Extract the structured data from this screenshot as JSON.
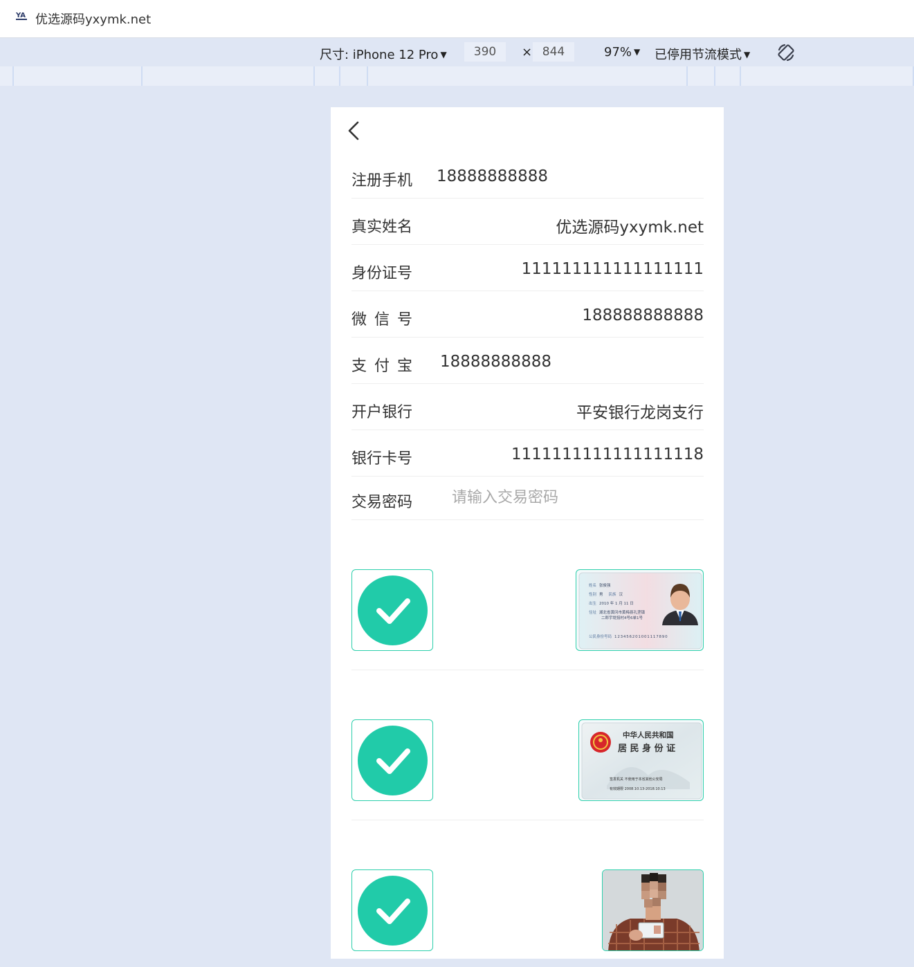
{
  "browser": {
    "tab_title": "优选源码yxymk.net",
    "favicon": "site-logo-icon"
  },
  "devtools": {
    "size_label": "尺寸: iPhone 12 Pro",
    "width": "390",
    "times": "×",
    "height": "844",
    "zoom": "97%",
    "throttle": "已停用节流模式",
    "rotate_icon": "rotate-icon"
  },
  "form": {
    "rows": [
      {
        "label": "注册手机",
        "value": "18888888888",
        "align": "left"
      },
      {
        "label": "真实姓名",
        "value": "优选源码yxymk.net",
        "align": "right"
      },
      {
        "label": "身份证号",
        "value": "111111111111111111",
        "align": "right"
      },
      {
        "label": "微 信 号",
        "value": "188888888888",
        "align": "right"
      },
      {
        "label": "支 付 宝",
        "value": "18888888888",
        "align": "left"
      },
      {
        "label": "开户银行",
        "value": "平安银行龙岗支行",
        "align": "right"
      },
      {
        "label": "银行卡号",
        "value": "1111111111111111118",
        "align": "right"
      }
    ],
    "password": {
      "label": "交易密码",
      "placeholder": "请输入交易密码",
      "value": ""
    }
  },
  "uploads": {
    "status_icon": "check-circle-icon",
    "accent": "#21cba9",
    "id_front": {
      "name_label": "姓名",
      "name": "张俊强",
      "sex_label": "性别",
      "sex": "男",
      "ethnic_label": "民族",
      "ethnic": "汉",
      "birth_label": "出生",
      "birth": "2010 年 1 月 11 日",
      "addr_label": "住址",
      "addr1": "湖北省黄冈市黄梅县孔垄镇",
      "addr2": "二郎宇堤拐村4号6单1号",
      "id_label": "公民身份号码",
      "id": "123456201001117890"
    },
    "id_back": {
      "country": "中华人民共和国",
      "title": "居 民 身 份 证",
      "authority": "签发机关  不使用于本省其他公安局",
      "validity": "有效期限  2008.10.13-2018.10.13"
    },
    "handheld_icon": "person-holding-id-photo"
  }
}
